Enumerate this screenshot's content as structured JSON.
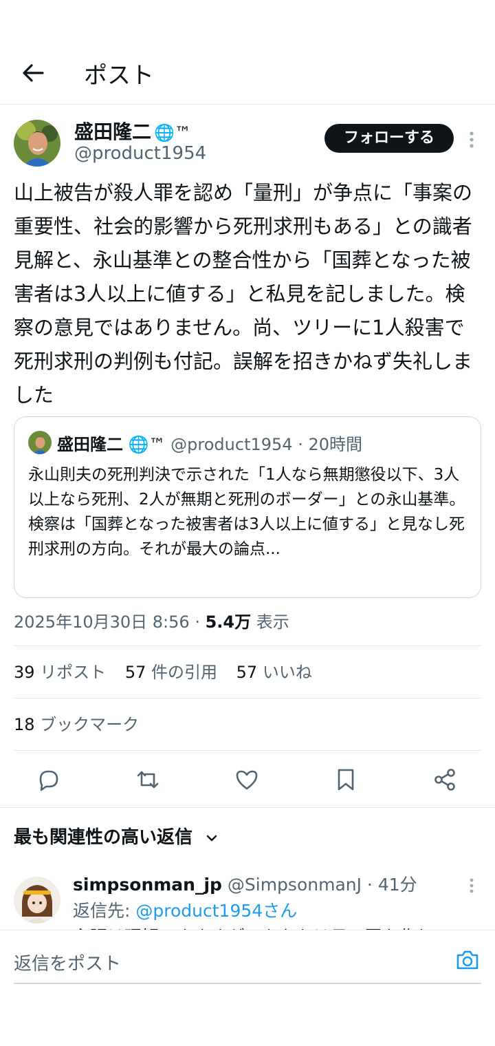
{
  "header": {
    "title": "ポスト",
    "back_icon": "arrow-left-icon"
  },
  "post": {
    "author_name": "盛田隆二",
    "author_badge": "🌐™",
    "author_handle": "@product1954",
    "follow_label": "フォローする",
    "text": "山上被告が殺人罪を認め「量刑」が争点に「事案の重要性、社会的影響から死刑求刑もある」との識者見解と、永山基準との整合性から「国葬となった被害者は3人以上に値する」と私見を記しました。検察の意見ではありません。尚、ツリーに1人殺害で死刑求刑の判例も付記。誤解を招きかねず失礼しました",
    "timestamp": "2025年10月30日 8:56",
    "views_count": "5.4万",
    "views_label": "表示"
  },
  "quote": {
    "name": "盛田隆二",
    "badge": "🌐™",
    "handle_meta": "@product1954 · 20時間",
    "text": "永山則夫の死刑判決で示された「1人なら無期懲役以下、3人以上なら死刑、2人が無期と死刑のボーダー」との永山基準。検察は「国葬となった被害者は3人以上に値する」と見なし死刑求刑の方向。それが最大の論点..."
  },
  "stats": {
    "reposts_count": "39",
    "reposts_label": "リポスト",
    "quotes_count": "57",
    "quotes_label": "件の引用",
    "likes_count": "57",
    "likes_label": "いいね",
    "bookmarks_count": "18",
    "bookmarks_label": "ブックマーク"
  },
  "sort": {
    "label": "最も関連性の高い返信"
  },
  "reply": {
    "name": "simpsonman_jp",
    "handle_meta": "@SimpsonmanJ · 41分",
    "to_label": "返信先:",
    "to_handle": "@product1954さん",
    "preview": "主張は理解できますが、あなたは日…国を作り"
  },
  "composer": {
    "placeholder": "返信をポスト"
  },
  "colors": {
    "accent": "#1d9bf0",
    "text": "#0f1419",
    "muted": "#536471",
    "border": "#e6e9eb"
  }
}
